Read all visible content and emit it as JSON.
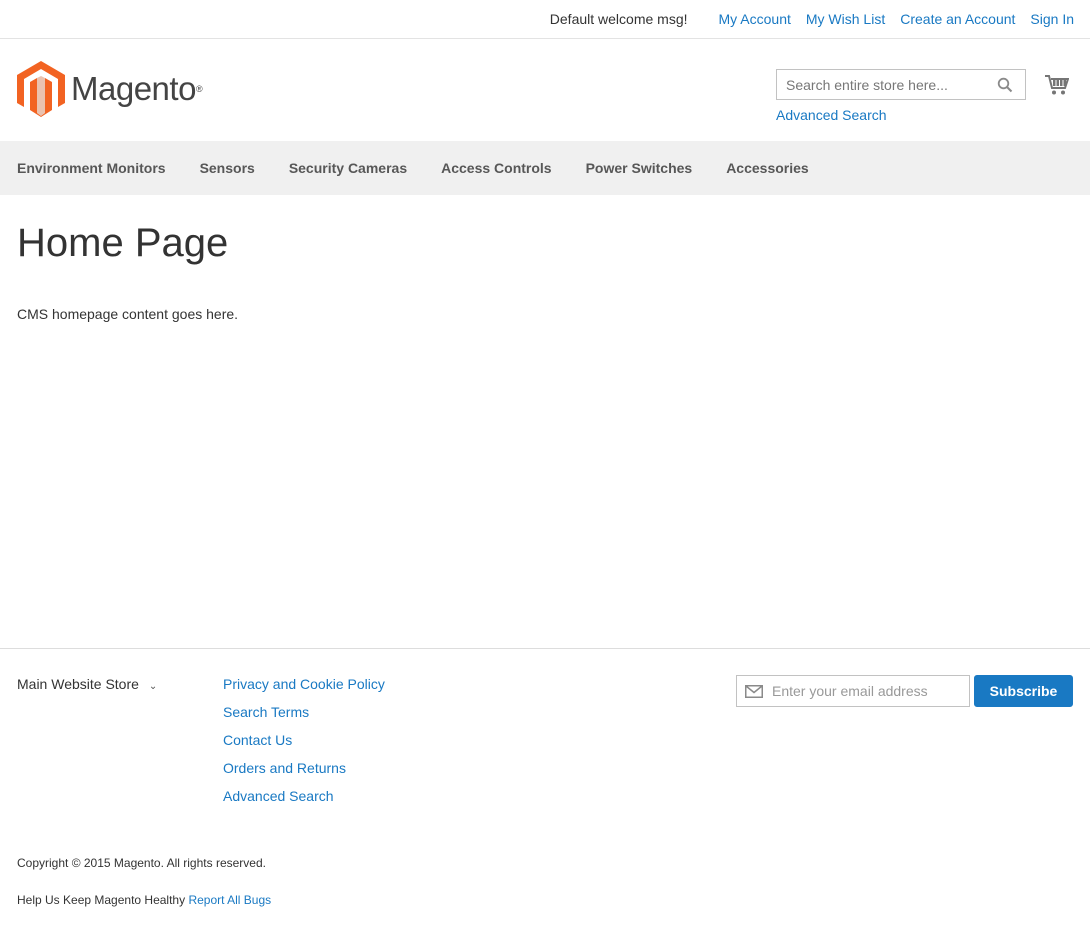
{
  "topbar": {
    "welcome": "Default welcome msg!",
    "links": [
      "My Account",
      "My Wish List",
      "Create an Account",
      "Sign In"
    ]
  },
  "header": {
    "logo_text": "Magento",
    "logo_reg": "®",
    "search_placeholder": "Search entire store here...",
    "advanced_search": "Advanced Search",
    "icons": {
      "search": "search-icon",
      "cart": "cart-icon",
      "logo": "magento-logo-icon"
    },
    "logo_colors": {
      "orange": "#f26322",
      "dark": "#444444"
    }
  },
  "nav": {
    "items": [
      "Environment Monitors",
      "Sensors",
      "Security Cameras",
      "Access Controls",
      "Power Switches",
      "Accessories"
    ]
  },
  "main": {
    "title": "Home Page",
    "content": "CMS homepage content goes here."
  },
  "footer": {
    "store_switcher": "Main Website Store",
    "links": [
      "Privacy and Cookie Policy",
      "Search Terms",
      "Contact Us",
      "Orders and Returns",
      "Advanced Search"
    ],
    "newsletter_placeholder": "Enter your email address",
    "subscribe_label": "Subscribe",
    "copyright": "Copyright © 2015 Magento. All rights reserved.",
    "bugs_text": "Help Us Keep Magento Healthy",
    "bugs_link": "Report All Bugs",
    "accent_color": "#1979c3"
  }
}
